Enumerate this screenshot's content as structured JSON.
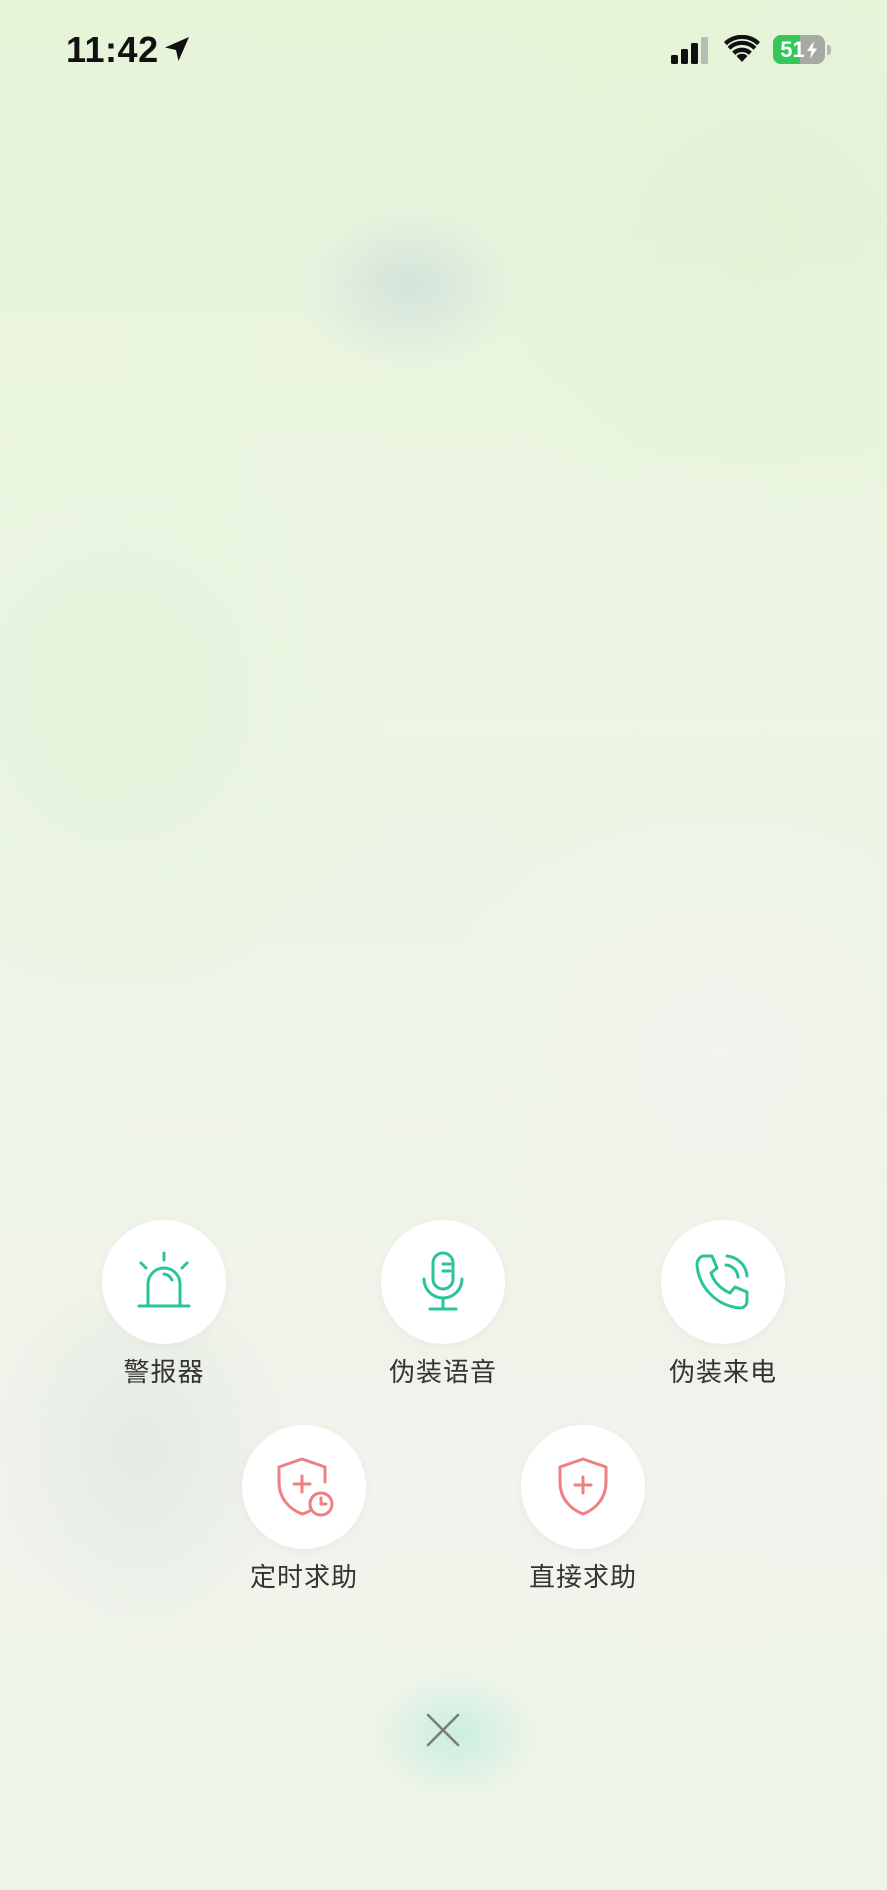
{
  "status_bar": {
    "time": "11:42",
    "battery_percent": "51",
    "battery_level": 0.51,
    "icons": [
      "location-arrow-icon",
      "cellular-signal-icon",
      "wifi-icon",
      "battery-icon",
      "charging-bolt-icon"
    ]
  },
  "actions": {
    "row1": [
      {
        "label": "警报器",
        "icon": "siren-icon"
      },
      {
        "label": "伪装语音",
        "icon": "microphone-icon"
      },
      {
        "label": "伪装来电",
        "icon": "phone-ringing-icon"
      }
    ],
    "row2": [
      {
        "label": "定时求助",
        "icon": "shield-plus-clock-icon"
      },
      {
        "label": "直接求助",
        "icon": "shield-plus-icon"
      }
    ]
  },
  "close": {
    "icon": "close-icon"
  },
  "colors": {
    "green_icon": "#2bc49a",
    "red_icon": "#ee7f82",
    "label_text": "#333333",
    "battery_green": "#34c759"
  }
}
